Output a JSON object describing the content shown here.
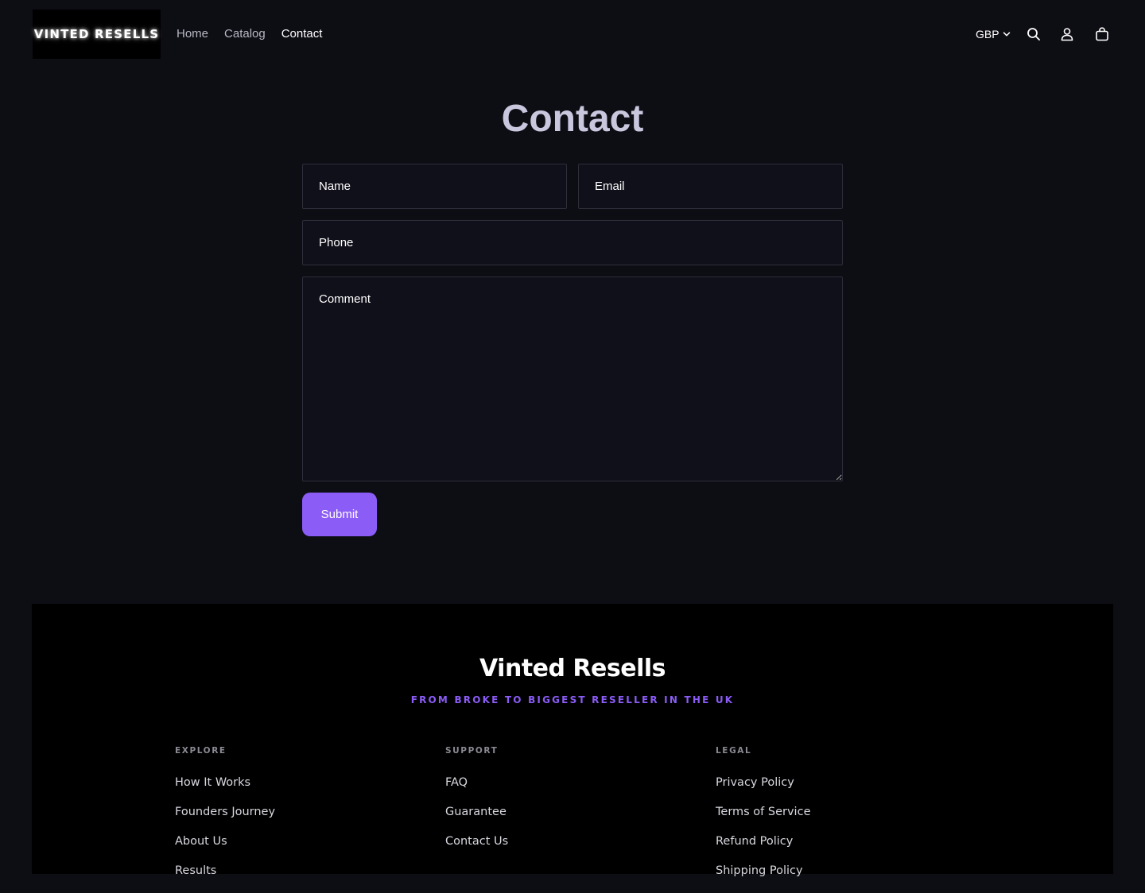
{
  "header": {
    "logo_text": "VINTED RESELLS",
    "nav": [
      {
        "label": "Home"
      },
      {
        "label": "Catalog"
      },
      {
        "label": "Contact"
      }
    ],
    "currency": "GBP"
  },
  "main": {
    "title": "Contact",
    "form": {
      "name_placeholder": "Name",
      "email_placeholder": "Email",
      "phone_placeholder": "Phone",
      "comment_placeholder": "Comment",
      "submit_label": "Submit"
    }
  },
  "footer": {
    "brand": "Vinted Resells",
    "tagline": "FROM BROKE TO BIGGEST RESELLER IN THE UK",
    "columns": [
      {
        "heading": "EXPLORE",
        "links": [
          "How It Works",
          "Founders Journey",
          "About Us",
          "Results"
        ]
      },
      {
        "heading": "SUPPORT",
        "links": [
          "FAQ",
          "Guarantee",
          "Contact Us"
        ]
      },
      {
        "heading": "LEGAL",
        "links": [
          "Privacy Policy",
          "Terms of Service",
          "Refund Policy",
          "Shipping Policy"
        ]
      }
    ]
  },
  "colors": {
    "background": "#0d0d14",
    "accent": "#8b5cf6",
    "footer_bg": "#000000",
    "title": "#c9c7de"
  },
  "icons": [
    "chevron-down-icon",
    "search-icon",
    "account-icon",
    "cart-icon"
  ]
}
